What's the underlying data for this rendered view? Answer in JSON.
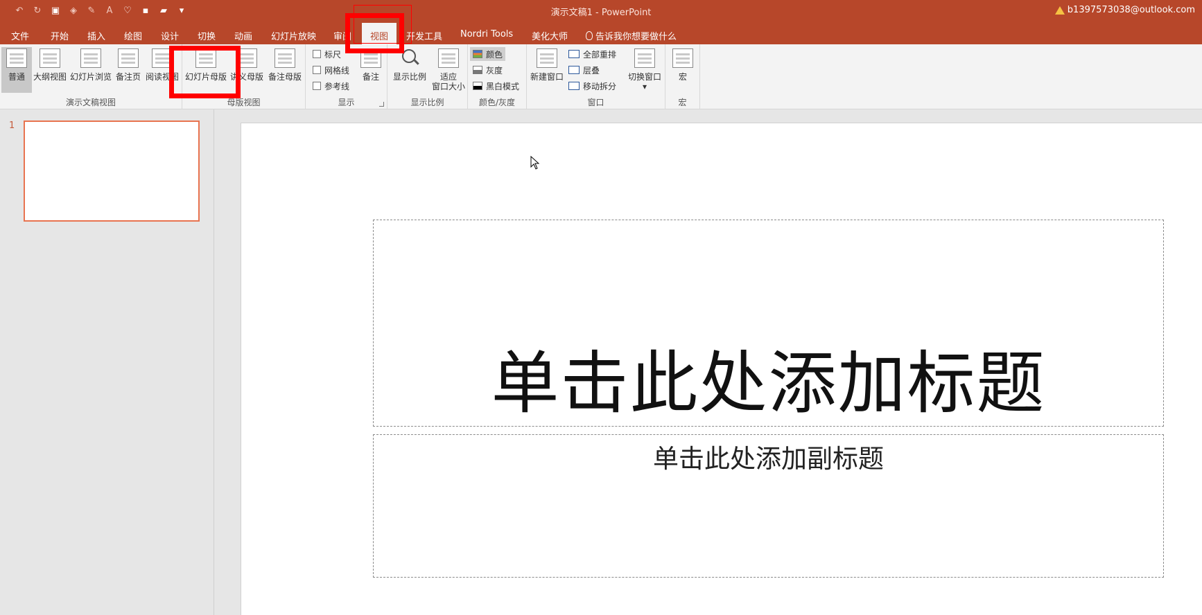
{
  "window": {
    "doc_title": "演示文稿1  -  PowerPoint",
    "account": "b1397573038@outlook.com"
  },
  "tabs": [
    {
      "label": "文件"
    },
    {
      "label": "开始"
    },
    {
      "label": "插入"
    },
    {
      "label": "绘图"
    },
    {
      "label": "设计"
    },
    {
      "label": "切换"
    },
    {
      "label": "动画"
    },
    {
      "label": "幻灯片放映"
    },
    {
      "label": "审阅"
    },
    {
      "label": "视图"
    },
    {
      "label": "开发工具"
    },
    {
      "label": "Nordri Tools"
    },
    {
      "label": "美化大师"
    }
  ],
  "tell_me": "告诉我你想要做什么",
  "ribbon": {
    "presentation_views": {
      "label": "演示文稿视图",
      "buttons": [
        "普通",
        "大纲视图",
        "幻灯片浏览",
        "备注页",
        "阅读视图"
      ]
    },
    "master_views": {
      "label": "母版视图",
      "buttons": [
        "幻灯片母版",
        "讲义母版",
        "备注母版"
      ]
    },
    "show": {
      "label": "显示",
      "checks": [
        "标尺",
        "网格线",
        "参考线"
      ],
      "notes": "备注"
    },
    "zoom": {
      "label": "显示比例",
      "zoom_btn": "显示比例",
      "fit_btn_line1": "适应",
      "fit_btn_line2": "窗口大小"
    },
    "color": {
      "label": "颜色/灰度",
      "items": [
        "颜色",
        "灰度",
        "黑白模式"
      ]
    },
    "window": {
      "label": "窗口",
      "new_window": "新建窗口",
      "items": [
        "全部重排",
        "层叠",
        "移动拆分"
      ],
      "switch": "切换窗口"
    },
    "macros": {
      "label": "宏",
      "button": "宏"
    }
  },
  "slides": {
    "number": "1",
    "title_placeholder": "单击此处添加标题",
    "subtitle_placeholder": "单击此处添加副标题"
  }
}
